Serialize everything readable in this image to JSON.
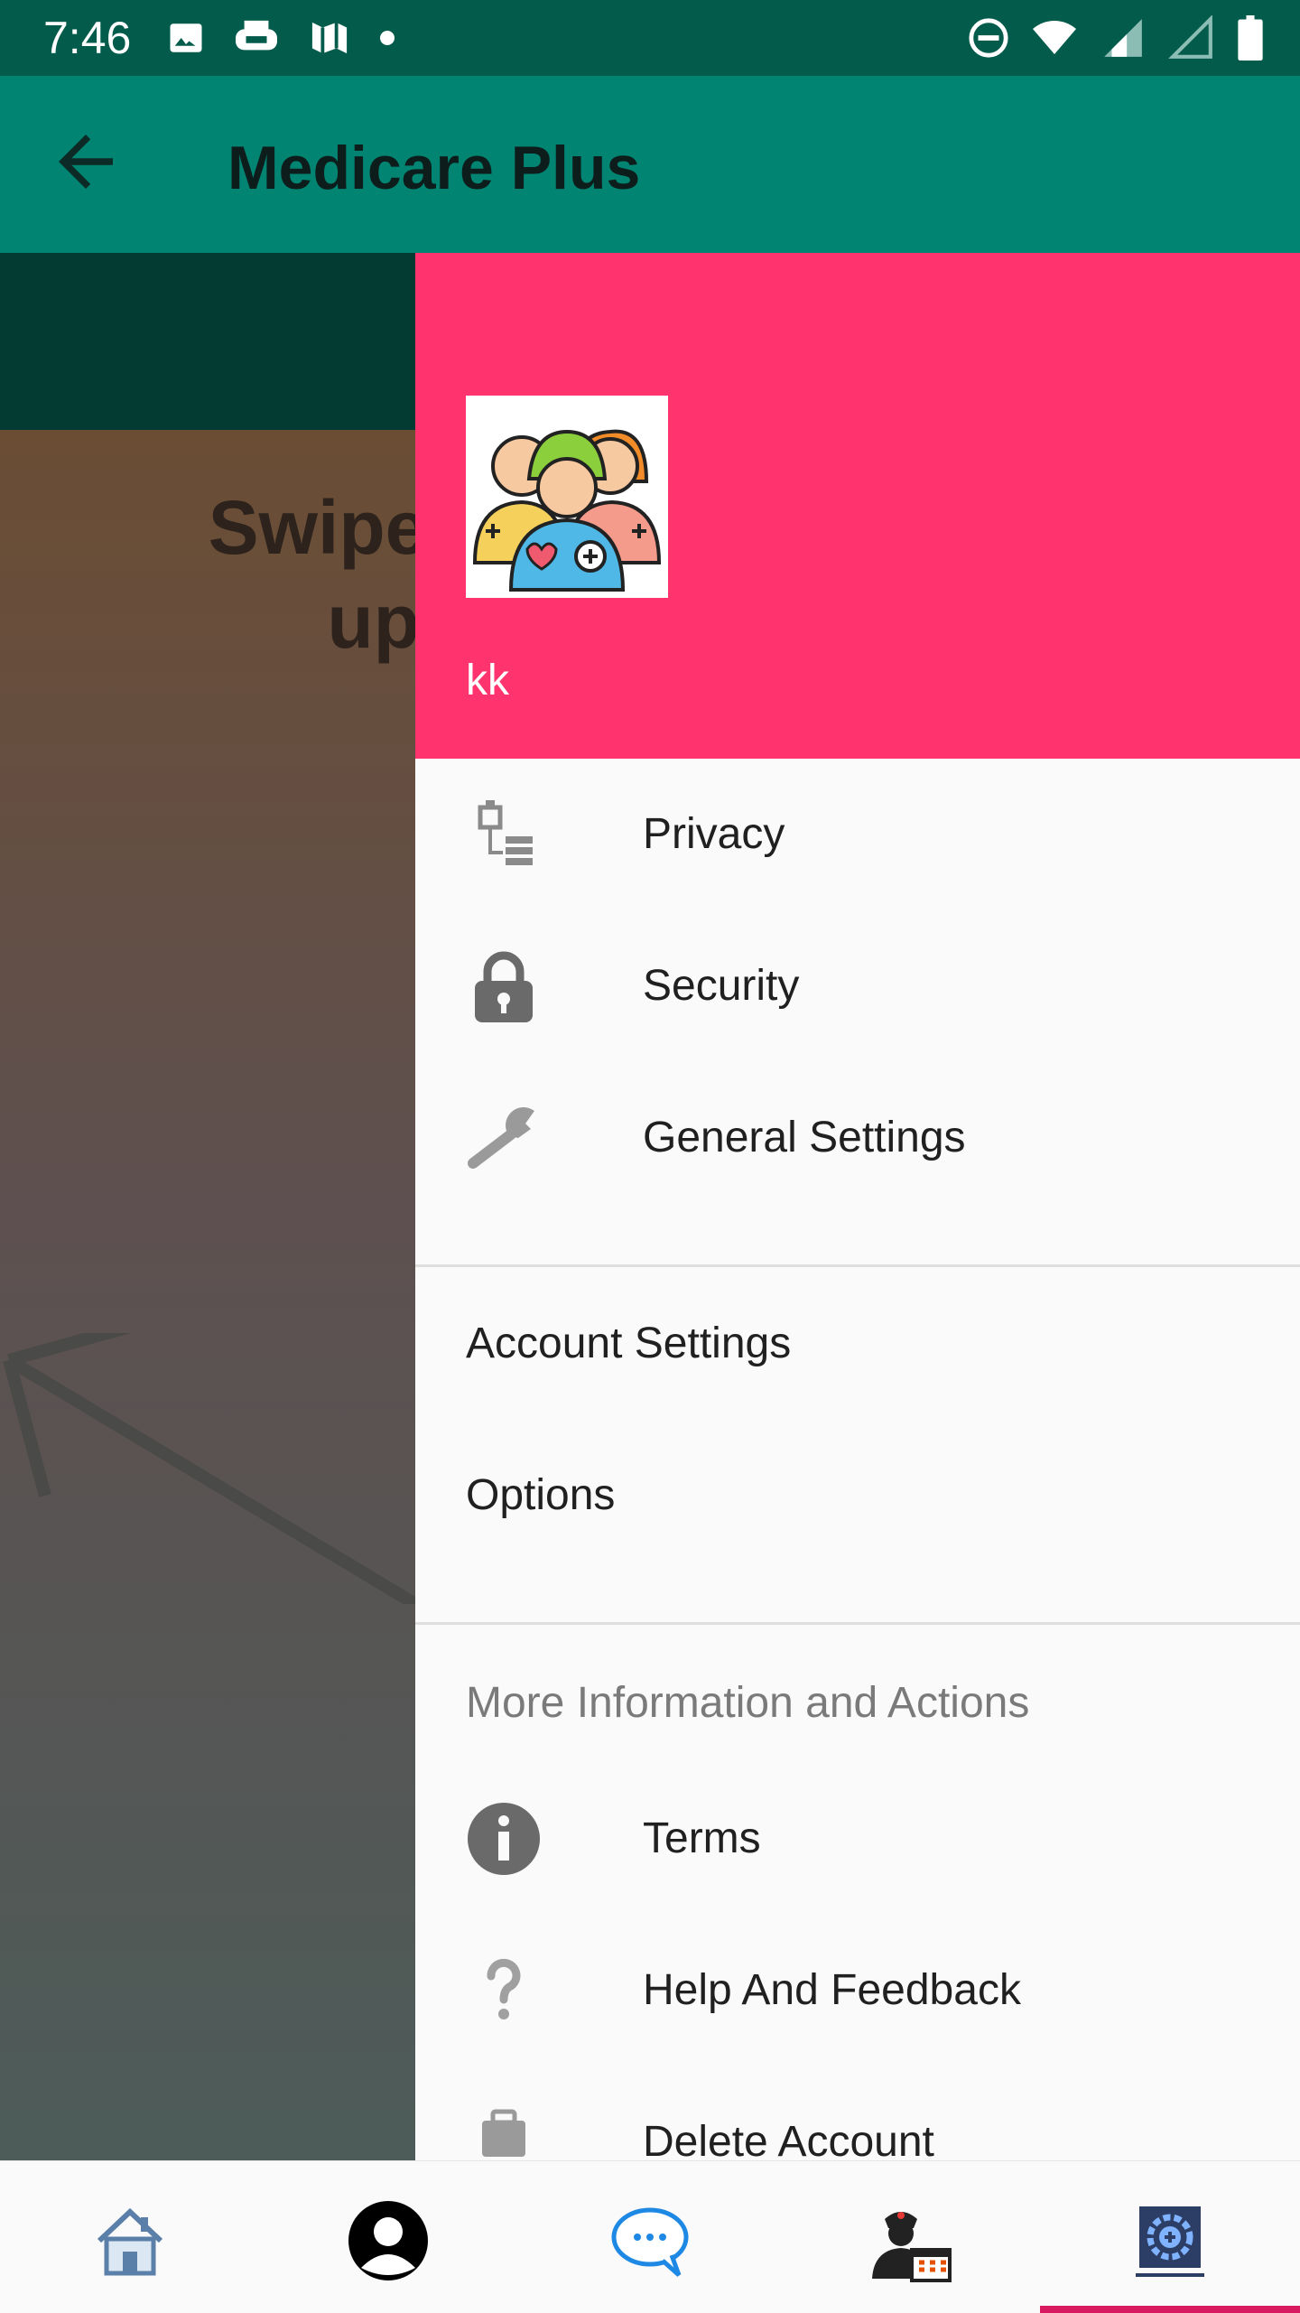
{
  "status_bar": {
    "time": "7:46",
    "left_icons": [
      "image-icon",
      "print-icon",
      "maps-icon",
      "dot-icon"
    ],
    "right_icons": [
      "do-not-disturb-icon",
      "wifi-icon",
      "signal-icon",
      "signal-empty-icon",
      "battery-icon"
    ]
  },
  "app_bar": {
    "title": "Medicare Plus",
    "back_icon": "arrow-back-icon",
    "background": "#028472"
  },
  "background_content": {
    "text_line1": "Swipe diag",
    "text_line2": "up to"
  },
  "drawer": {
    "header_color": "#ff336d",
    "avatar_icon": "medical-team-icon",
    "user_name": "kk",
    "items_top": [
      {
        "label": "Privacy",
        "icon": "privacy-icon"
      },
      {
        "label": "Security",
        "icon": "lock-icon"
      },
      {
        "label": "General Settings",
        "icon": "wrench-icon"
      }
    ],
    "items_middle": [
      {
        "label": "Account Settings"
      },
      {
        "label": "Options"
      }
    ],
    "section_header": "More Information and Actions",
    "items_bottom": [
      {
        "label": "Terms",
        "icon": "info-icon"
      },
      {
        "label": "Help And Feedback",
        "icon": "help-icon"
      },
      {
        "label": "Delete Account",
        "icon": "briefcase-icon"
      }
    ]
  },
  "bottom_nav": {
    "items": [
      "home-icon",
      "profile-icon",
      "chat-icon",
      "doctor-appointment-icon",
      "medical-settings-icon"
    ],
    "selected_index": 4,
    "indicator_color": "#d81b60"
  }
}
